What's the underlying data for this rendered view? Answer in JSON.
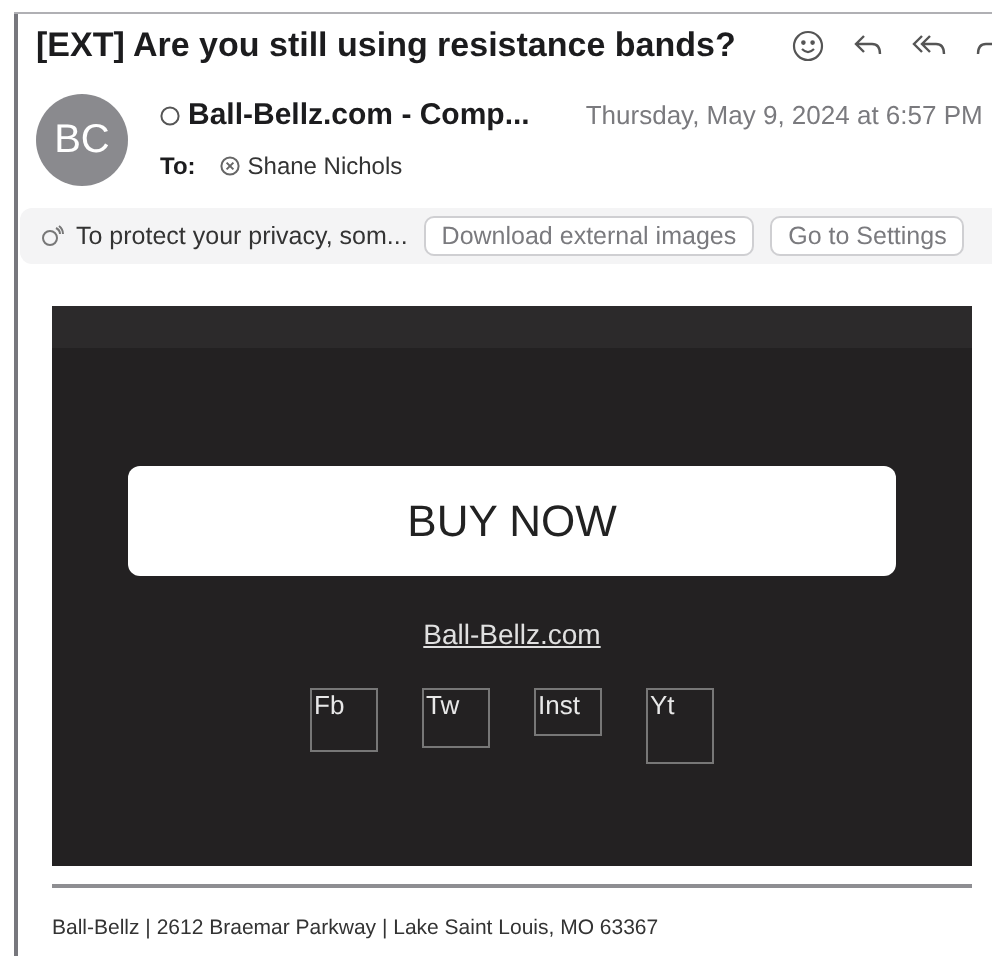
{
  "subject": "[EXT]  Are you still using resistance bands?",
  "sender": {
    "initials": "BC",
    "name": "Ball-Bellz.com - Comp...",
    "date": "Thursday, May 9, 2024 at 6:57 PM",
    "to_label": "To:",
    "recipient": "Shane Nichols"
  },
  "privacy_banner": {
    "text": "To protect your privacy, som...",
    "buttons": [
      "Download external images",
      "Go to Settings"
    ]
  },
  "email_body": {
    "buy_button": "BUY NOW",
    "link": "Ball-Bellz.com",
    "social_images": [
      "Fb",
      "Tw",
      "Inst",
      "Yt"
    ]
  },
  "footer": "Ball-Bellz | 2612 Braemar Parkway | Lake Saint Louis, MO 63367"
}
